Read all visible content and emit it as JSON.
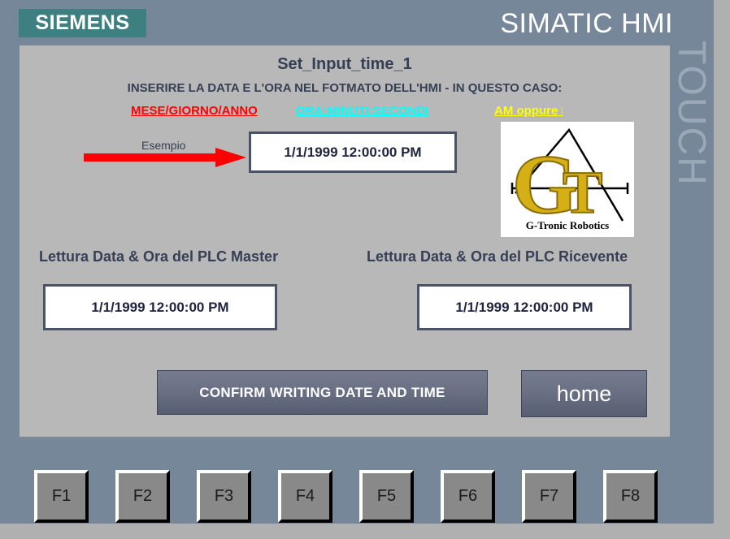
{
  "branding": {
    "vendor_logo": "SIEMENS",
    "wordmark": "SIMATIC HMI",
    "panel_type": "TOUCH",
    "colors": {
      "desktop_background": "#76879a",
      "vendor_logo_background": "#3e7f82",
      "panel_background": "#b8b8b8",
      "heading_text": "#373f55",
      "legend_date": "#ff0000",
      "legend_time": "#00ffff",
      "legend_ampm": "#ffff00",
      "arrow": "#ff0000",
      "button_face": "#6b7184",
      "field_border": "#4a5268",
      "fkey_face": "#898989",
      "bottom_bar": "#b0b0b0"
    }
  },
  "screen": {
    "title": "Set_Input_time_1",
    "subtitle": "INSERIRE LA DATA E L'ORA NEL FOTMATO DELL'HMI - IN QUESTO CASO:",
    "legend": [
      {
        "label": "MESE/GIORNO/ANNO",
        "color": "#ff0000"
      },
      {
        "label": "ORA:MINUTI:SECONDI",
        "color": "#00ffff"
      },
      {
        "label": "AM oppure P",
        "color": "#ffff00"
      }
    ],
    "example": {
      "label": "Esempio",
      "value": "1/1/1999 12:00:00 PM"
    },
    "logo": {
      "caption": "G-Tronic Robotics"
    },
    "readings": [
      {
        "caption": "Lettura Data & Ora del PLC Master",
        "value": "1/1/1999 12:00:00 PM"
      },
      {
        "caption": "Lettura Data & Ora del PLC Ricevente",
        "value": "1/1/1999 12:00:00 PM"
      }
    ],
    "buttons": {
      "confirm": "CONFIRM WRITING DATE AND TIME",
      "home": "home"
    }
  },
  "function_keys": [
    {
      "label": "F1"
    },
    {
      "label": "F2"
    },
    {
      "label": "F3"
    },
    {
      "label": "F4"
    },
    {
      "label": "F5"
    },
    {
      "label": "F6"
    },
    {
      "label": "F7"
    },
    {
      "label": "F8"
    }
  ]
}
